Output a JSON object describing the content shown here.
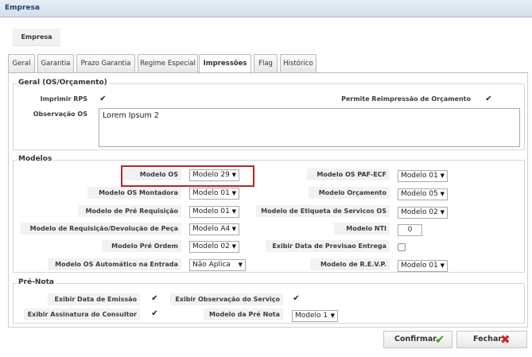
{
  "window": {
    "title": "Empresa"
  },
  "breadcrumb": {
    "label": "Empresa"
  },
  "tabs": [
    "Geral",
    "Garantia",
    "Prazo Garantia",
    "Regime Especial",
    "Impressões",
    "Flag",
    "Histórico"
  ],
  "geral": {
    "legend": "Geral (OS/Orçamento)",
    "imprimir_rps_label": "Imprimir RPS",
    "permite_reimpressao_label": "Permite Reimpressão de Orçamento",
    "observacao_label": "Observação OS",
    "observacao_value": "Lorem Ipsum 2"
  },
  "modelos": {
    "legend": "Modelos",
    "modelo_os_label": "Modelo OS",
    "modelo_os_value": "Modelo 29",
    "modelo_os_montadora_label": "Modelo OS Montadora",
    "modelo_os_montadora_value": "Modelo 01",
    "modelo_pre_requisicao_label": "Modelo de Pré Requisição",
    "modelo_pre_requisicao_value": "Modelo 01",
    "modelo_requisicao_devolucao_label": "Modelo de Requisição/Devolução de Peça",
    "modelo_requisicao_devolucao_value": "Modelo A4",
    "modelo_pre_ordem_label": "Modelo Pré Ordem",
    "modelo_pre_ordem_value": "Modelo 02",
    "modelo_os_automatico_label": "Modelo OS Automático na Entrada",
    "modelo_os_automatico_value": "Não Aplica",
    "modelo_os_paf_ecf_label": "Modelo OS PAF-ECF",
    "modelo_os_paf_ecf_value": "Modelo 01",
    "modelo_orcamento_label": "Modelo Orçamento",
    "modelo_orcamento_value": "Modelo 05",
    "modelo_etiqueta_label": "Modelo de Etiqueta de Servicos OS",
    "modelo_etiqueta_value": "Modelo 02",
    "modelo_nti_label": "Modelo NTI",
    "modelo_nti_value": "0",
    "exibir_data_previsao_label": "Exibir Data de Previsao Entrega",
    "modelo_revp_label": "Modelo de R.E.V.P.",
    "modelo_revp_value": "Modelo 01"
  },
  "prenota": {
    "legend": "Pré-Nota",
    "exibir_data_emissao_label": "Exibir Data de Emissão",
    "exibir_observacao_servico_label": "Exibir Observação do Serviço",
    "exibir_assinatura_label": "Exibir Assinatura do Consultor",
    "modelo_pre_nota_label": "Modelo da Pré Nota",
    "modelo_pre_nota_value": "Modelo 1"
  },
  "buttons": {
    "confirmar": "Confirmar",
    "fechar": "Fechar"
  },
  "colors": {
    "highlight": "#b3262c",
    "confirm_icon": "#4a9a1f",
    "close_icon": "#c8262b"
  }
}
